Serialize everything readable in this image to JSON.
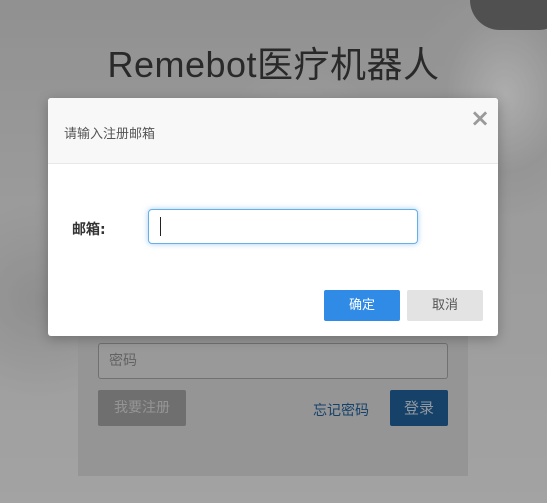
{
  "background": {
    "app_title": "Remebot医疗机器人",
    "login": {
      "password_placeholder": "密码",
      "register_label": "我要注册",
      "forgot_label": "忘记密码",
      "login_label": "登录"
    }
  },
  "modal": {
    "title": "请输入注册邮箱",
    "close_icon": "×",
    "email_label": "邮箱:",
    "email_value": "",
    "confirm_label": "确定",
    "cancel_label": "取消"
  },
  "colors": {
    "confirm_button": "#2f8be6",
    "login_button": "#1f5a91",
    "focus_border": "#66afe9"
  }
}
